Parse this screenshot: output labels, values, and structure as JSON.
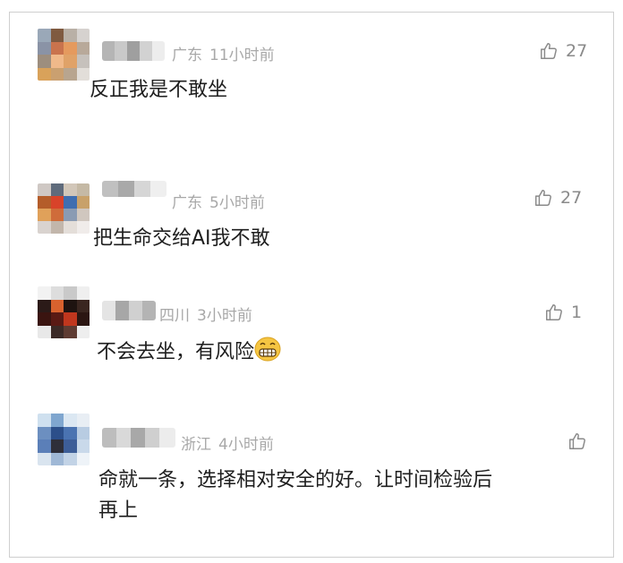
{
  "comments": [
    {
      "region": "广东",
      "time": "11小时前",
      "text": "反正我是不敢坐",
      "likes": "27"
    },
    {
      "region": "广东",
      "time": "5小时前",
      "text": "把生命交给AI我不敢",
      "likes": "27"
    },
    {
      "region": "四川",
      "time": "3小时前",
      "text": "不会去坐，有风险",
      "emoji": "grinning-face",
      "likes": "1"
    },
    {
      "region": "浙江",
      "time": "4小时前",
      "text_line1": "命就一条，选择相对安全的好。让时间检验后",
      "text_line2": "再上",
      "likes": ""
    }
  ],
  "icons": {
    "like": "thumbs-up-icon"
  }
}
